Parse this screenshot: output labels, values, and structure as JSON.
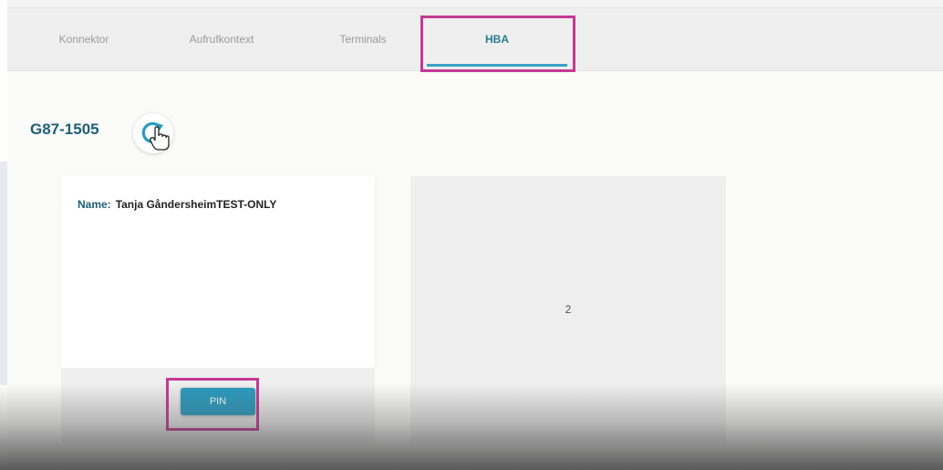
{
  "tabs": {
    "konnektor": "Konnektor",
    "aufrufkontext": "Aufrufkontext",
    "terminals": "Terminals",
    "hba": "HBA"
  },
  "header": {
    "title": "G87-1505"
  },
  "card": {
    "name_label": "Name:",
    "name_value": "Tanja GåndersheimTEST-ONLY",
    "pin_label": "PIN"
  },
  "slot": {
    "number": "2"
  },
  "colors": {
    "accent": "#2b9cc0",
    "title": "#1f5f74",
    "highlight": "#c43a94"
  },
  "icons": {
    "refresh": "refresh-icon",
    "cursor": "hand-cursor-icon"
  }
}
